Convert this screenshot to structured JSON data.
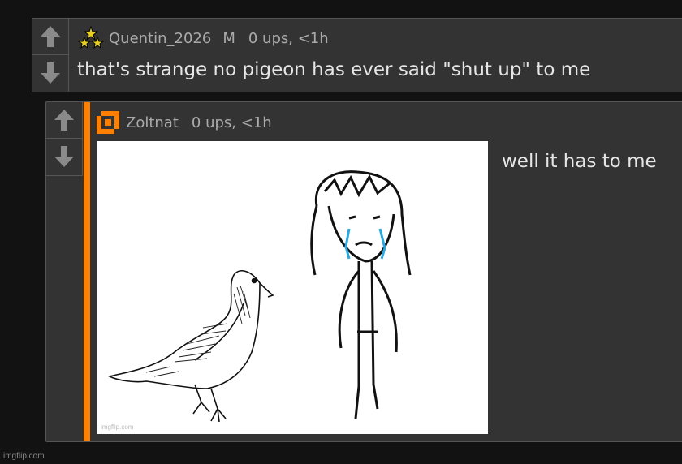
{
  "comments": [
    {
      "username": "Quentin_2026",
      "badge": "M",
      "stats": "0 ups, <1h",
      "text": "that's strange no pigeon has ever said \"shut up\" to me",
      "avatar_icon": "three-stars-icon"
    },
    {
      "username": "Zoltnat",
      "stats": "0 ups, <1h",
      "text": "well it has to me",
      "avatar_icon": "orange-pixel-ring-icon",
      "accent_color": "#ff8000",
      "image_watermark": "imgflip.com"
    }
  ],
  "vote": {
    "up_icon": "arrow-up-icon",
    "down_icon": "arrow-down-icon"
  },
  "site_watermark": "imgflip.com"
}
